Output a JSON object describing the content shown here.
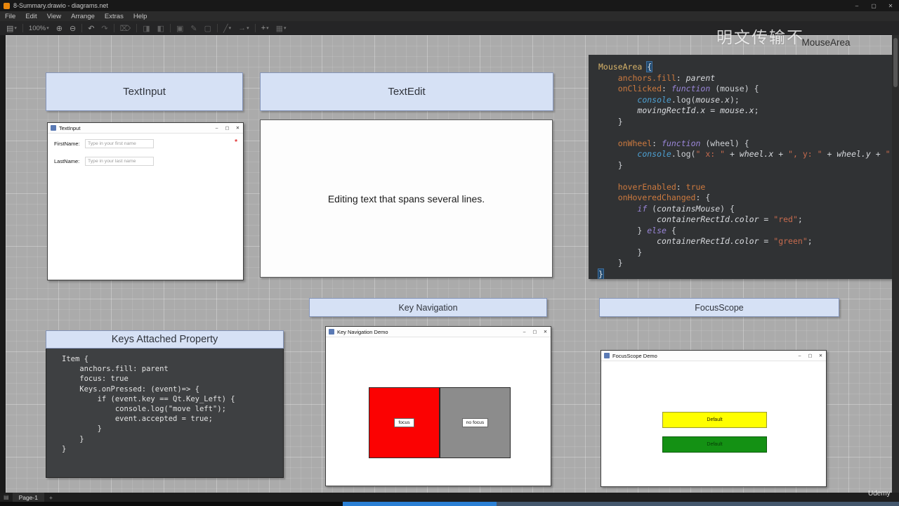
{
  "window": {
    "title": "8-Summary.drawio - diagrams.net",
    "controls": {
      "minimize": "–",
      "maximize": "▢",
      "close": "✕"
    }
  },
  "menubar": {
    "items": [
      "File",
      "Edit",
      "View",
      "Arrange",
      "Extras",
      "Help"
    ]
  },
  "toolbar": {
    "zoom_level": "100%"
  },
  "icons": {
    "view": "▤",
    "caret": "▾",
    "zoom_in": "⊕",
    "zoom_out": "⊖",
    "undo": "↶",
    "redo": "↷",
    "delete": "⌦",
    "to_front": "◨",
    "to_back": "◧",
    "fill": "▣",
    "pencil": "✎",
    "shadow": "▢",
    "line": "╱",
    "arrow": "→",
    "plus": "+",
    "table": "▦",
    "pages": "▤",
    "min": "–",
    "max": "▢",
    "close": "✕"
  },
  "watermarks": {
    "top": "明文传输不",
    "bottom": "Udemy"
  },
  "headers": {
    "textinput": "TextInput",
    "textedit": "TextEdit",
    "keynav": "Key Navigation",
    "focusscope": "FocusScope",
    "keys": "Keys Attached Property",
    "mousearea": "MouseArea"
  },
  "textedit_box": {
    "text": "Editing text that spans several lines."
  },
  "textinput_window": {
    "title": "TextInput",
    "rows": [
      {
        "label": "FirstName:",
        "placeholder": "Type in your first name"
      },
      {
        "label": "LastName:",
        "placeholder": "Type in your last name"
      }
    ],
    "required_marker": "*"
  },
  "keynav_window": {
    "title": "Key Navigation Demo",
    "boxes": [
      {
        "label": "focus",
        "color": "#fb0202"
      },
      {
        "label": "no focus",
        "color": "#8c8c8c"
      }
    ]
  },
  "focusscope_window": {
    "title": "FocusScope Demo",
    "buttons": [
      {
        "label": "Default",
        "color": "#ffff00",
        "text_color": "#1a1a00",
        "border": "#9a9a30"
      },
      {
        "label": "Default",
        "color": "#149114",
        "text_color": "#titleContrast",
        "border": "#0b5c0b"
      }
    ]
  },
  "footer": {
    "page_tab": "Page-1",
    "add_page": "+"
  },
  "progress": {
    "played_color": "#2a7fd4"
  },
  "mousearea_code": {
    "lines": [
      [
        [
          "type",
          "MouseArea"
        ],
        [
          "p",
          " "
        ],
        [
          "hl",
          "{"
        ]
      ],
      [
        [
          "p",
          "    "
        ],
        [
          "prop",
          "anchors.fill"
        ],
        [
          "p",
          ": "
        ],
        [
          "it",
          "parent"
        ]
      ],
      [
        [
          "p",
          "    "
        ],
        [
          "prop",
          "onClicked"
        ],
        [
          "p",
          ": "
        ],
        [
          "kw",
          "function"
        ],
        [
          "p",
          " (mouse) {"
        ]
      ],
      [
        [
          "p",
          "        "
        ],
        [
          "fn",
          "console"
        ],
        [
          "p",
          ".log("
        ],
        [
          "it",
          "mouse.x"
        ],
        [
          "p",
          ");"
        ]
      ],
      [
        [
          "p",
          "        "
        ],
        [
          "it",
          "movingRectId.x"
        ],
        [
          "p",
          " = "
        ],
        [
          "it",
          "mouse.x"
        ],
        [
          "p",
          ";"
        ]
      ],
      [
        [
          "p",
          "    }"
        ]
      ],
      [],
      [
        [
          "p",
          "    "
        ],
        [
          "prop",
          "onWheel"
        ],
        [
          "p",
          ": "
        ],
        [
          "kw",
          "function"
        ],
        [
          "p",
          " (wheel) {"
        ]
      ],
      [
        [
          "p",
          "        "
        ],
        [
          "fn",
          "console"
        ],
        [
          "p",
          ".log("
        ],
        [
          "str",
          "\" x: \""
        ],
        [
          "p",
          " + "
        ],
        [
          "it",
          "wheel.x"
        ],
        [
          "p",
          " + "
        ],
        [
          "str",
          "\", y: \""
        ],
        [
          "p",
          " + "
        ],
        [
          "it",
          "wheel.y"
        ],
        [
          "p",
          " + "
        ],
        [
          "str",
          "\""
        ]
      ],
      [
        [
          "p",
          "    }"
        ]
      ],
      [],
      [
        [
          "p",
          "    "
        ],
        [
          "prop",
          "hoverEnabled"
        ],
        [
          "p",
          ": "
        ],
        [
          "bool",
          "true"
        ]
      ],
      [
        [
          "p",
          "    "
        ],
        [
          "prop",
          "onHoveredChanged"
        ],
        [
          "p",
          ": {"
        ]
      ],
      [
        [
          "p",
          "        "
        ],
        [
          "kw",
          "if"
        ],
        [
          "p",
          " ("
        ],
        [
          "it",
          "containsMouse"
        ],
        [
          "p",
          ") {"
        ]
      ],
      [
        [
          "p",
          "            "
        ],
        [
          "it",
          "containerRectId.color"
        ],
        [
          "p",
          " = "
        ],
        [
          "str",
          "\"red\""
        ],
        [
          "p",
          ";"
        ]
      ],
      [
        [
          "p",
          "        } "
        ],
        [
          "kw",
          "else"
        ],
        [
          "p",
          " {"
        ]
      ],
      [
        [
          "p",
          "            "
        ],
        [
          "it",
          "containerRectId.color"
        ],
        [
          "p",
          " = "
        ],
        [
          "str",
          "\"green\""
        ],
        [
          "p",
          ";"
        ]
      ],
      [
        [
          "p",
          "        }"
        ]
      ],
      [
        [
          "p",
          "    }"
        ]
      ],
      [
        [
          "hl",
          "}"
        ]
      ]
    ]
  },
  "keys_code": {
    "lines": [
      [
        [
          "p",
          "Item {"
        ]
      ],
      [
        [
          "p",
          "    anchors.fill: parent"
        ]
      ],
      [
        [
          "p",
          "    focus: true"
        ]
      ],
      [
        [
          "p",
          "    Keys.onPressed: (event)=> {"
        ]
      ],
      [
        [
          "p",
          "        if (event.key == Qt.Key_Left) {"
        ]
      ],
      [
        [
          "p",
          "            console.log(\"move left\");"
        ]
      ],
      [
        [
          "p",
          "            event.accepted = true;"
        ]
      ],
      [
        [
          "p",
          "        }"
        ]
      ],
      [
        [
          "p",
          "    }"
        ]
      ],
      [
        [
          "p",
          "}"
        ]
      ]
    ]
  }
}
